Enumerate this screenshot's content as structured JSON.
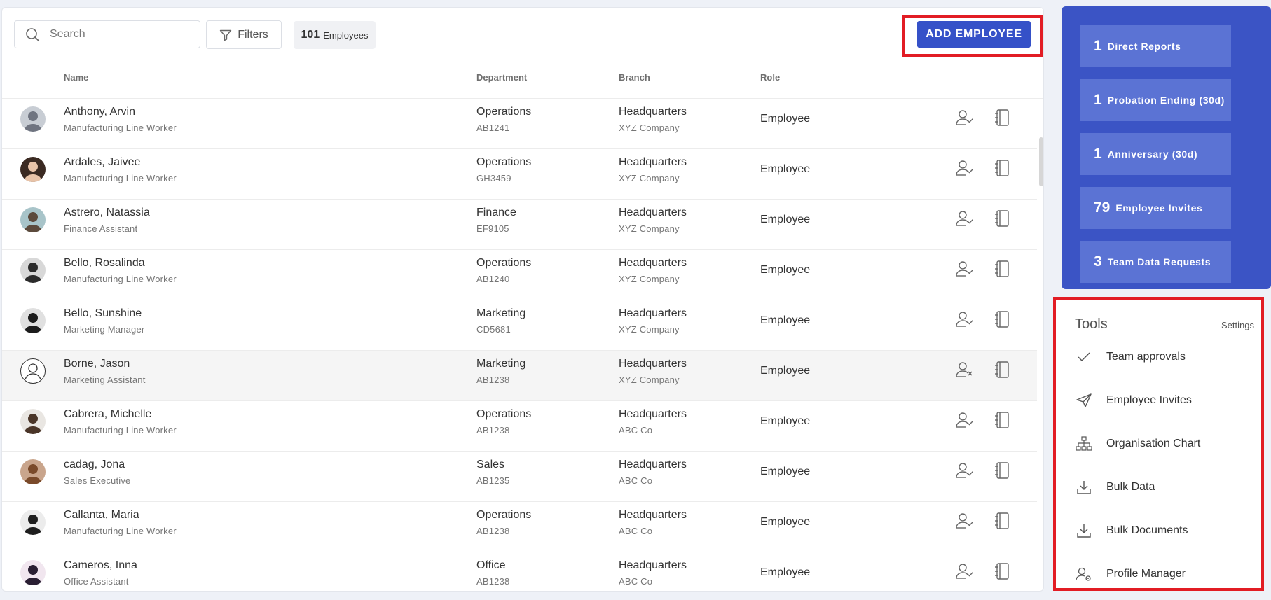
{
  "toolbar": {
    "search_placeholder": "Search",
    "filters_label": "Filters",
    "count": "101",
    "count_label": "Employees",
    "add_label": "ADD EMPLOYEE"
  },
  "columns": {
    "name": "Name",
    "department": "Department",
    "branch": "Branch",
    "role": "Role"
  },
  "employees": [
    {
      "name": "Anthony, Arvin",
      "title": "Manufacturing Line Worker",
      "department": "Operations",
      "code": "AB1241",
      "branch": "Headquarters",
      "company": "XYZ Company",
      "role": "Employee",
      "status": "active"
    },
    {
      "name": "Ardales, Jaivee",
      "title": "Manufacturing Line Worker",
      "department": "Operations",
      "code": "GH3459",
      "branch": "Headquarters",
      "company": "XYZ Company",
      "role": "Employee",
      "status": "active"
    },
    {
      "name": "Astrero, Natassia",
      "title": "Finance Assistant",
      "department": "Finance",
      "code": "EF9105",
      "branch": "Headquarters",
      "company": "XYZ Company",
      "role": "Employee",
      "status": "active"
    },
    {
      "name": "Bello, Rosalinda",
      "title": "Manufacturing Line Worker",
      "department": "Operations",
      "code": "AB1240",
      "branch": "Headquarters",
      "company": "XYZ Company",
      "role": "Employee",
      "status": "active"
    },
    {
      "name": "Bello, Sunshine",
      "title": "Marketing Manager",
      "department": "Marketing",
      "code": "CD5681",
      "branch": "Headquarters",
      "company": "XYZ Company",
      "role": "Employee",
      "status": "active"
    },
    {
      "name": "Borne, Jason",
      "title": "Marketing Assistant",
      "department": "Marketing",
      "code": "AB1238",
      "branch": "Headquarters",
      "company": "XYZ Company",
      "role": "Employee",
      "status": "inactive"
    },
    {
      "name": "Cabrera, Michelle",
      "title": "Manufacturing Line Worker",
      "department": "Operations",
      "code": "AB1238",
      "branch": "Headquarters",
      "company": "ABC Co",
      "role": "Employee",
      "status": "active"
    },
    {
      "name": "cadag, Jona",
      "title": "Sales Executive",
      "department": "Sales",
      "code": "AB1235",
      "branch": "Headquarters",
      "company": "ABC Co",
      "role": "Employee",
      "status": "active"
    },
    {
      "name": "Callanta, Maria",
      "title": "Manufacturing Line Worker",
      "department": "Operations",
      "code": "AB1238",
      "branch": "Headquarters",
      "company": "ABC Co",
      "role": "Employee",
      "status": "active"
    },
    {
      "name": "Cameros, Inna",
      "title": "Office Assistant",
      "department": "Office",
      "code": "AB1238",
      "branch": "Headquarters",
      "company": "ABC Co",
      "role": "Employee",
      "status": "active"
    }
  ],
  "stats": [
    {
      "count": "1",
      "label": "Direct Reports"
    },
    {
      "count": "1",
      "label": "Probation Ending (30d)"
    },
    {
      "count": "1",
      "label": "Anniversary (30d)"
    },
    {
      "count": "79",
      "label": "Employee Invites"
    },
    {
      "count": "3",
      "label": "Team Data Requests"
    }
  ],
  "tools": {
    "title": "Tools",
    "settings": "Settings",
    "items": [
      {
        "label": "Team approvals",
        "icon": "check-icon"
      },
      {
        "label": "Employee Invites",
        "icon": "send-icon"
      },
      {
        "label": "Organisation Chart",
        "icon": "org-chart-icon"
      },
      {
        "label": "Bulk Data",
        "icon": "download-icon"
      },
      {
        "label": "Bulk Documents",
        "icon": "download-icon"
      },
      {
        "label": "Profile Manager",
        "icon": "user-settings-icon"
      }
    ]
  },
  "colors": {
    "accent": "#3551c8",
    "stats_bg": "#3b54c5",
    "stat_card": "#5b73d4",
    "highlight": "#e21c24"
  }
}
